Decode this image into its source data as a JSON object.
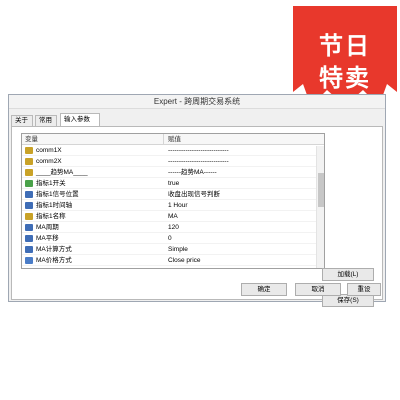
{
  "badge": {
    "line1": "节日",
    "line2": "特卖",
    "color": "#e8382c"
  },
  "window": {
    "title": "Expert - 跨周期交易系统",
    "tabs": [
      {
        "label": "关于",
        "active": false
      },
      {
        "label": "常用",
        "active": false
      },
      {
        "label": "输入参数",
        "active": true
      }
    ],
    "table": {
      "col_variable": "变量",
      "col_value": "赋值",
      "rows": [
        {
          "icon": "ab-icon",
          "name": "comm1X",
          "value": "----------------------------"
        },
        {
          "icon": "ab-icon",
          "name": "comm2X",
          "value": "----------------------------"
        },
        {
          "icon": "ab-icon",
          "name": "____趋势MA____",
          "value": "------趋势MA------"
        },
        {
          "icon": "bool-icon",
          "name": "指标1开关",
          "value": "true"
        },
        {
          "icon": "number-icon",
          "name": "指标1信号位置",
          "value": "收盘出现信号判断"
        },
        {
          "icon": "number-icon",
          "name": "指标1时间轴",
          "value": "1 Hour"
        },
        {
          "icon": "ab-icon",
          "name": "指标1名称",
          "value": "MA"
        },
        {
          "icon": "number-icon",
          "name": "MA周期",
          "value": "120"
        },
        {
          "icon": "number-icon",
          "name": "MA平移",
          "value": "0"
        },
        {
          "icon": "number-icon",
          "name": "MA计算方式",
          "value": "Simple"
        },
        {
          "icon": "enum-icon",
          "name": "MA价格方式",
          "value": "Close price"
        }
      ]
    },
    "buttons": {
      "load": "加载(L)",
      "save": "保存(S)",
      "ok": "确定",
      "cancel": "取消",
      "reset": "重设"
    }
  }
}
